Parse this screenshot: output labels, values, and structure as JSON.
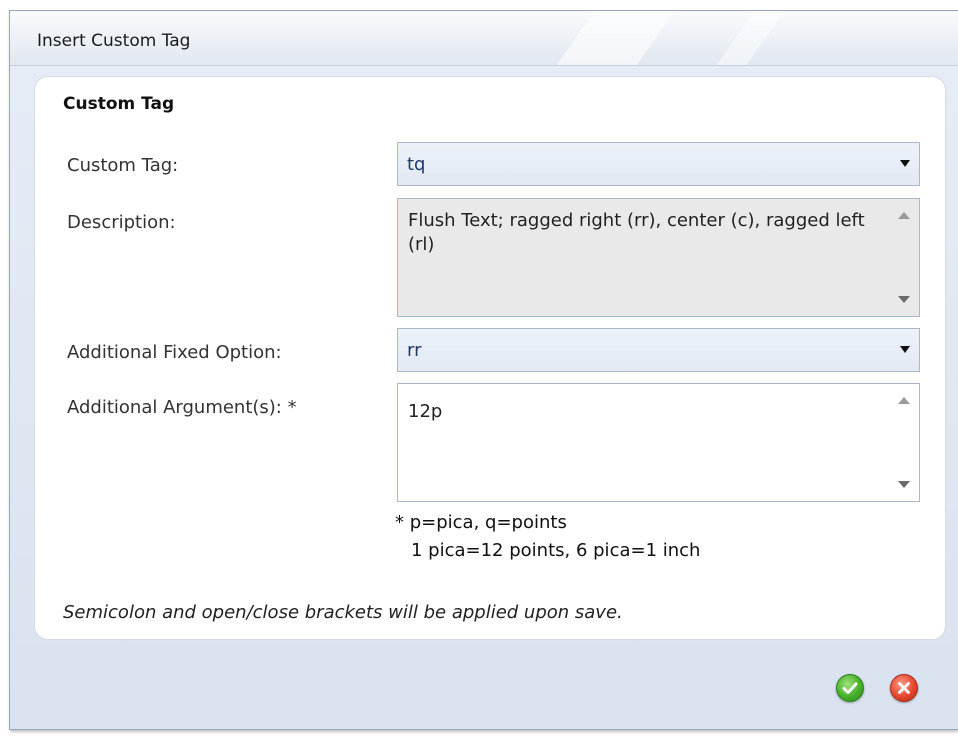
{
  "window": {
    "title": "Insert Custom Tag"
  },
  "form": {
    "section_title": "Custom Tag",
    "custom_tag": {
      "label": "Custom Tag:",
      "value": "tq"
    },
    "description": {
      "label": "Description:",
      "value": "Flush Text; ragged right (rr), center (c), ragged left (rl)"
    },
    "fixed_option": {
      "label": "Additional Fixed Option:",
      "value": "rr"
    },
    "arguments": {
      "label": "Additional Argument(s): *",
      "value": "12p"
    },
    "note_line1": "* p=pica, q=points",
    "note_line2": "1 pica=12 points, 6 pica=1 inch",
    "save_note": "Semicolon and open/close brackets will be applied upon save."
  },
  "actions": {
    "ok_icon": "green-check-circle-icon",
    "cancel_icon": "red-x-circle-icon"
  },
  "colors": {
    "ok": "#45b02a",
    "cancel": "#e5472e",
    "select_text": "#1f3a66"
  }
}
